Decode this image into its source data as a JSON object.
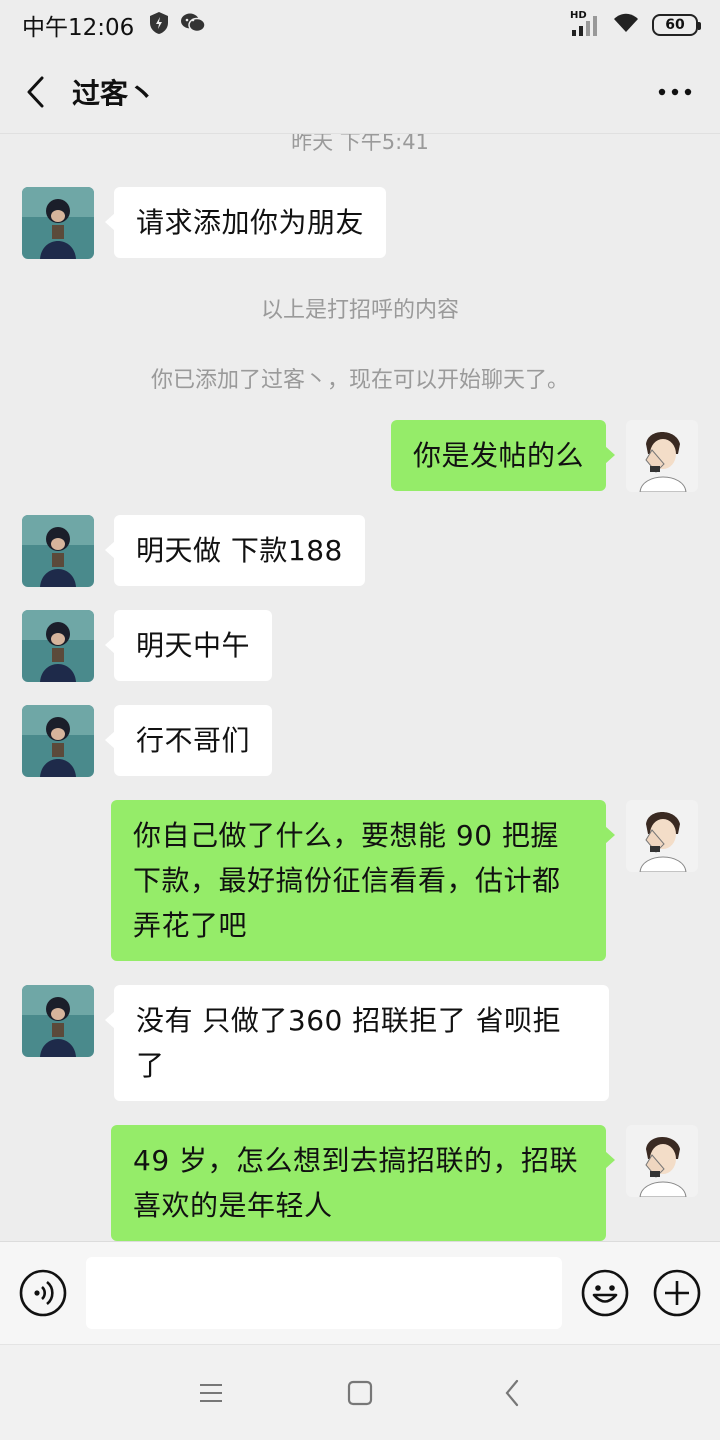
{
  "status": {
    "time": "中午12:06",
    "network_label": "HD",
    "battery": "60"
  },
  "header": {
    "title": "过客丶",
    "back_icon": "chevron-left-icon",
    "more_icon": "more-horizontal-icon"
  },
  "chat": {
    "timestamp": "昨天 下午5:41",
    "system_messages": [
      "以上是打招呼的内容",
      "你已添加了过客丶，现在可以开始聊天了。"
    ],
    "messages": [
      {
        "side": "left",
        "text": "请求添加你为朋友"
      },
      {
        "side": "right",
        "text": "你是发帖的么"
      },
      {
        "side": "left",
        "text": "明天做 下款188"
      },
      {
        "side": "left",
        "text": "明天中午"
      },
      {
        "side": "left",
        "text": "行不哥们"
      },
      {
        "side": "right",
        "lines": [
          "你自己做了什么，要想能 90 把握",
          "下款，最好搞份征信看看，估计都",
          "弄花了吧"
        ]
      },
      {
        "side": "left",
        "lines": [
          "没有 只做了360 招联拒了 省呗拒",
          "了"
        ]
      },
      {
        "side": "right",
        "lines": [
          "49 岁，怎么想到去搞招联的，招联",
          "喜欢的是年轻人"
        ]
      }
    ]
  },
  "input_bar": {
    "voice_icon": "voice-icon",
    "emoji_icon": "emoji-icon",
    "plus_icon": "plus-circle-icon",
    "input_value": ""
  },
  "system_nav": {
    "menu_icon": "menu-icon",
    "home_icon": "home-square-icon",
    "back_icon": "back-triangle-icon"
  },
  "colors": {
    "background": "#ededed",
    "bubble_self": "#95ec69",
    "bubble_other": "#ffffff",
    "system_text": "#9a9a9a"
  }
}
